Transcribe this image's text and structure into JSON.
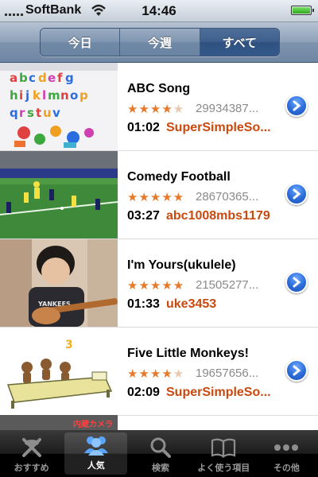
{
  "status_bar": {
    "carrier": "SoftBank",
    "time": "14:46"
  },
  "segmented": {
    "options": [
      "今日",
      "今週",
      "すべて"
    ],
    "selected": "すべて"
  },
  "videos": [
    {
      "title": "ABC Song",
      "rating": 4.5,
      "views": "29934387...",
      "duration": "01:02",
      "uploader": "SuperSimpleSo...",
      "thumbnail_icon": "alphabet-letters-thumbnail"
    },
    {
      "title": "Comedy Football",
      "rating": 5,
      "views": "28670365...",
      "duration": "03:27",
      "uploader": "abc1008mbs1179",
      "thumbnail_icon": "football-match-thumbnail"
    },
    {
      "title": "I'm Yours(ukulele)",
      "rating": 5,
      "views": "21505277...",
      "duration": "01:33",
      "uploader": "uke3453",
      "thumbnail_icon": "child-playing-ukulele-thumbnail"
    },
    {
      "title": "Five Little Monkeys!",
      "rating": 4.5,
      "views": "19657656...",
      "duration": "02:09",
      "uploader": "SuperSimpleSo...",
      "thumbnail_icon": "monkeys-on-bed-thumbnail"
    }
  ],
  "partial_thumbnail_text": "内蔵カメラ",
  "tab_bar": {
    "tabs": [
      {
        "label": "おすすめ",
        "icon": "featured-icon",
        "active": false
      },
      {
        "label": "人気",
        "icon": "people-icon",
        "active": true
      },
      {
        "label": "検索",
        "icon": "search-icon",
        "active": false
      },
      {
        "label": "よく使う項目",
        "icon": "book-icon",
        "active": false
      },
      {
        "label": "その他",
        "icon": "more-icon",
        "active": false
      }
    ]
  },
  "colors": {
    "star": "#e67a2a",
    "uploader": "#c9490f",
    "segment_active": "#33598a"
  }
}
